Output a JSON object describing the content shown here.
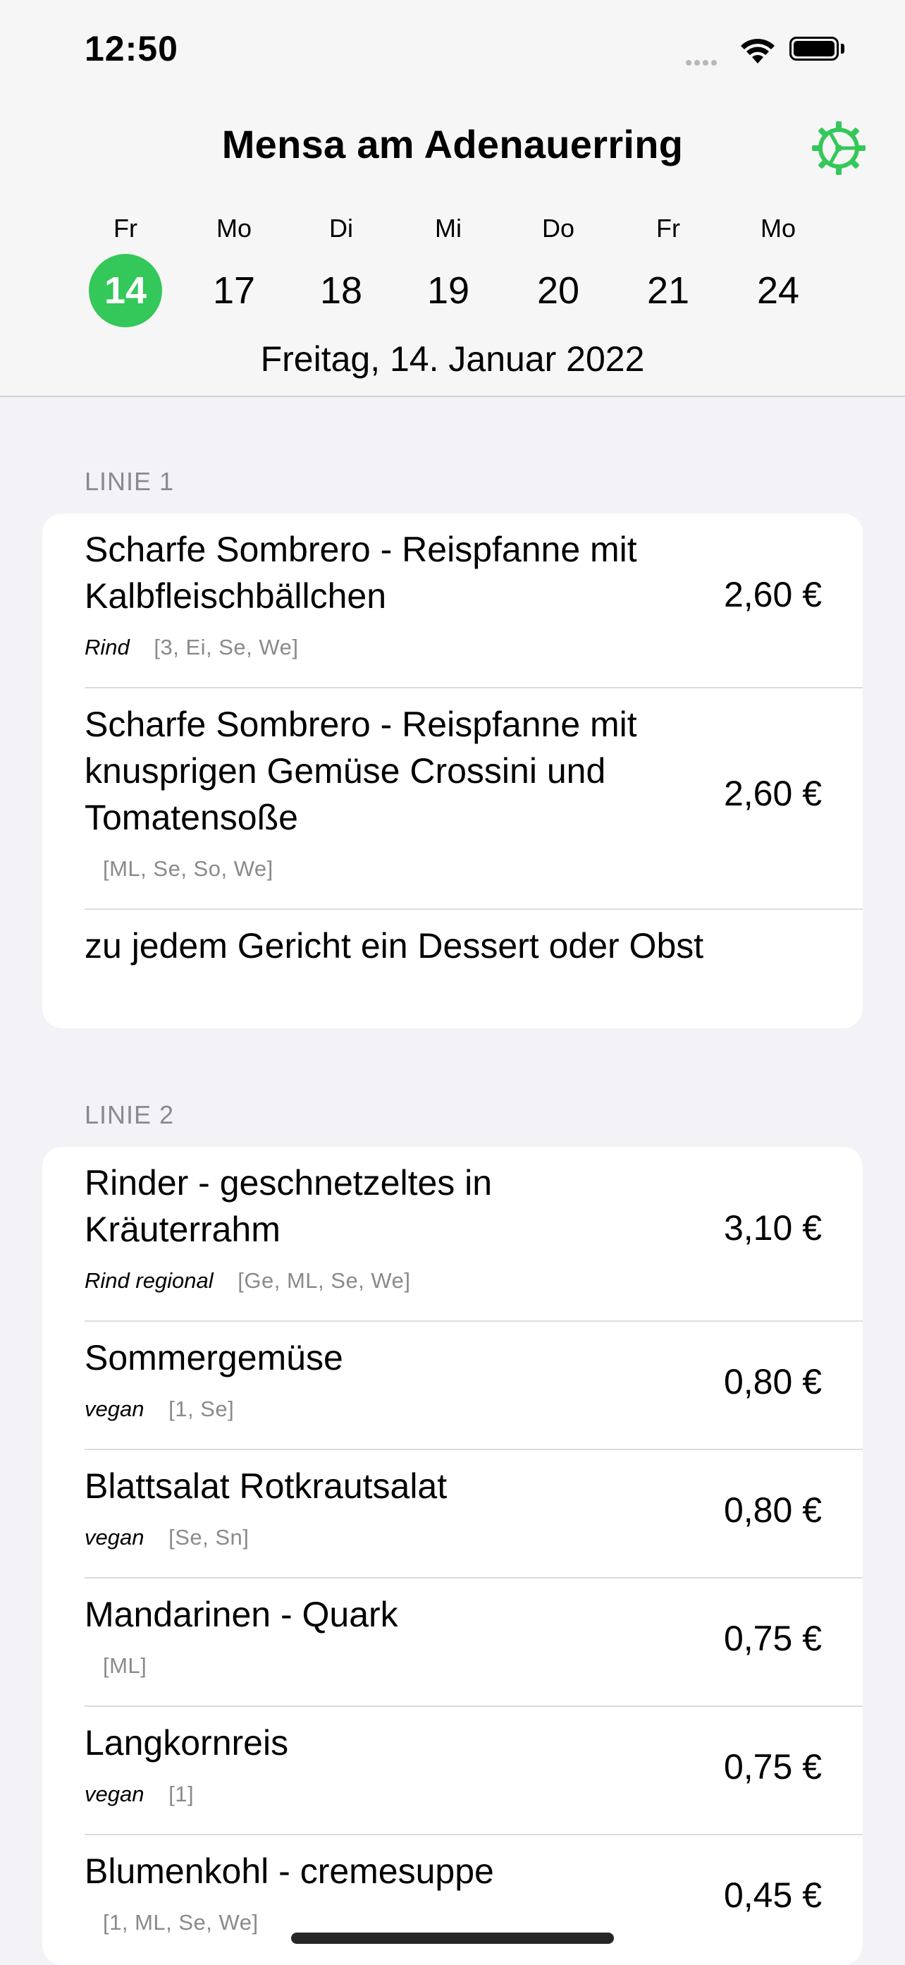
{
  "status": {
    "time": "12:50"
  },
  "title": "Mensa am Adenauerring",
  "week": [
    {
      "name": "Fr",
      "num": "14",
      "selected": true
    },
    {
      "name": "Mo",
      "num": "17"
    },
    {
      "name": "Di",
      "num": "18"
    },
    {
      "name": "Mi",
      "num": "19"
    },
    {
      "name": "Do",
      "num": "20"
    },
    {
      "name": "Fr",
      "num": "21"
    },
    {
      "name": "Mo",
      "num": "24"
    }
  ],
  "date_line": "Freitag, 14. Januar 2022",
  "sections": [
    {
      "title": "LINIE 1",
      "meals": [
        {
          "name": "Scharfe Sombrero - Reispfanne mit Kalbfleischbällchen",
          "tag": "Rind",
          "allergens": "[3, Ei, Se, We]",
          "price": "2,60 €"
        },
        {
          "name": "Scharfe Sombrero - Reispfanne mit knusprigen Gemüse Crossini und Tomatensoße",
          "tag": "",
          "allergens": "[ML, Se, So, We]",
          "price": "2,60 €"
        },
        {
          "name": "zu jedem Gericht ein Dessert oder Obst",
          "tag": "",
          "allergens": "",
          "price": ""
        }
      ]
    },
    {
      "title": "LINIE 2",
      "meals": [
        {
          "name": "Rinder - geschnetzeltes in Kräuterrahm",
          "tag": "Rind regional",
          "allergens": "[Ge, ML, Se, We]",
          "price": "3,10 €"
        },
        {
          "name": "Sommergemüse",
          "tag": "vegan",
          "allergens": "[1, Se]",
          "price": "0,80 €"
        },
        {
          "name": "Blattsalat Rotkrautsalat",
          "tag": "vegan",
          "allergens": "[Se, Sn]",
          "price": "0,80 €"
        },
        {
          "name": "Mandarinen - Quark",
          "tag": "",
          "allergens": "[ML]",
          "price": "0,75 €"
        },
        {
          "name": "Langkornreis",
          "tag": "vegan",
          "allergens": "[1]",
          "price": "0,75 €"
        },
        {
          "name": "Blumenkohl - cremesuppe",
          "tag": "",
          "allergens": "[1, ML, Se, We]",
          "price": "0,45 €"
        }
      ]
    }
  ],
  "colors": {
    "accent": "#34c759",
    "background": "#f2f2f7",
    "secondary_text": "#8a8a8e"
  },
  "icons": {
    "settings": "gear-icon",
    "wifi": "wifi-icon",
    "battery": "battery-icon",
    "signal": "cellular-signal-icon"
  }
}
